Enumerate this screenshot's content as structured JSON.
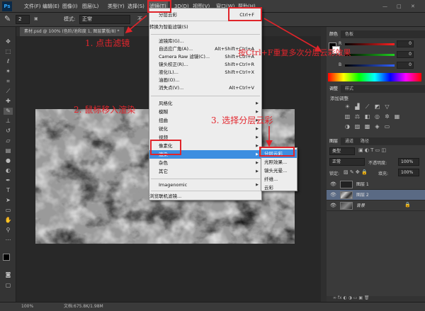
{
  "app": {
    "logo": "Ps"
  },
  "menubar": {
    "items": [
      "文件(F)",
      "编辑(E)",
      "图像(I)",
      "图层(L)",
      "类型(Y)",
      "选择(S)",
      "滤镜(T)",
      "3D(D)",
      "视图(V)",
      "窗口(W)",
      "帮助(H)"
    ]
  },
  "options": {
    "mode_label": "模式:",
    "mode_value": "正常",
    "brush_size": "2",
    "opacity_label": "不"
  },
  "document": {
    "tab_title": "素材.psd @ 100% (色阶/池和度 1, 图层蒙版/8) *"
  },
  "filter_menu": {
    "top": {
      "label": "分层云彩",
      "shortcut": "Ctrl+F"
    },
    "convert": "转换为智能滤镜(S)",
    "group1": [
      {
        "label": "滤镜库(G)...",
        "shortcut": ""
      },
      {
        "label": "自适应广角(A)...",
        "shortcut": "Alt+Shift+Ctrl+A"
      },
      {
        "label": "Camera Raw 滤镜(C)...",
        "shortcut": "Shift+Ctrl+A"
      },
      {
        "label": "镜头校正(R)...",
        "shortcut": "Shift+Ctrl+R"
      },
      {
        "label": "液化(L)...",
        "shortcut": "Shift+Ctrl+X"
      },
      {
        "label": "油画(O)...",
        "shortcut": ""
      },
      {
        "label": "消失点(V)...",
        "shortcut": "Alt+Ctrl+V"
      }
    ],
    "group2": [
      "风格化",
      "模糊",
      "扭曲",
      "锐化",
      "视频",
      "像素化",
      "渲染",
      "杂色",
      "其它"
    ],
    "plugin": "Imagenomic",
    "browse": "浏览联机滤镜..."
  },
  "render_menu": {
    "items": [
      "分层云彩",
      "光照效果...",
      "镜头光晕...",
      "纤维...",
      "云彩"
    ]
  },
  "annotations": {
    "step1": "1. 点击滤镜",
    "step2": "2. 鼠标移入渲染",
    "step3": "3. 选择分层云彩",
    "tip": "按Ctrl+F重复多次分层云彩效果"
  },
  "panels": {
    "color_tabs": [
      "颜色",
      "色板"
    ],
    "channels": [
      {
        "label": "R",
        "value": "0",
        "color": "#ff3030"
      },
      {
        "label": "G",
        "value": "0",
        "color": "#30d030"
      },
      {
        "label": "B",
        "value": "0",
        "color": "#3a6cff"
      }
    ],
    "adjust_tabs": [
      "调整",
      "样式"
    ],
    "adjust_title": "添加调整",
    "layer_tabs": [
      "图层",
      "通道",
      "路径"
    ],
    "layer_filter": "类型",
    "blend_mode": "正常",
    "opacity_label": "不透明度:",
    "opacity_value": "100%",
    "lock_label": "锁定:",
    "fill_label": "填充:",
    "fill_value": "100%",
    "layers": [
      {
        "name": "图层 1",
        "selected": false
      },
      {
        "name": "图层 2",
        "selected": true
      },
      {
        "name": "背景",
        "selected": false
      }
    ]
  },
  "status": {
    "zoom": "100%",
    "doc_info": "文档:675.8K/1.98M"
  }
}
